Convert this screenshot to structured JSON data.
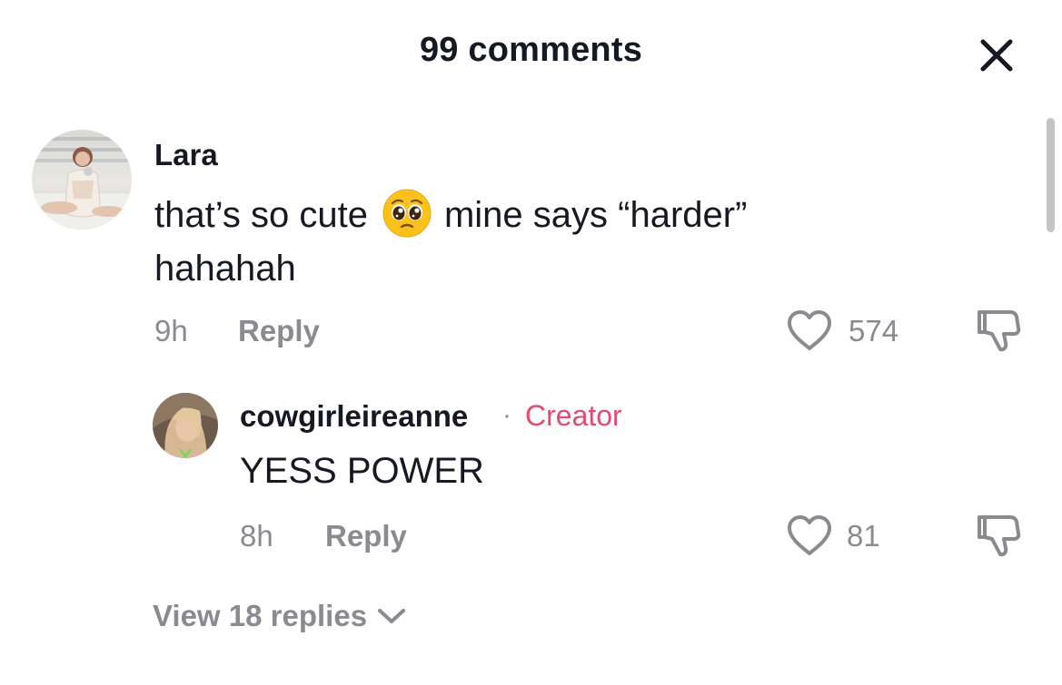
{
  "header": {
    "title": "99 comments"
  },
  "comments": [
    {
      "username": "Lara",
      "text_before_emoji": "that’s so cute",
      "emoji": "pleading-face",
      "text_after_emoji": "mine says “harder”",
      "text_line2": "hahahah",
      "time": "9h",
      "reply_label": "Reply",
      "likes": "574"
    }
  ],
  "reply": {
    "username": "cowgirleireanne",
    "separator": "·",
    "badge": "Creator",
    "text": "YESS POWER",
    "time": "8h",
    "reply_label": "Reply",
    "likes": "81"
  },
  "view_replies": {
    "label": "View 18 replies"
  },
  "colors": {
    "primary_text": "#161823",
    "secondary_text": "#8a8b91",
    "creator_badge": "#e54b6f",
    "scrollbar": "#c4c4c6"
  },
  "icons": [
    "close-icon",
    "heart-icon",
    "dislike-icon",
    "chevron-down-icon",
    "pleading-face-emoji"
  ]
}
